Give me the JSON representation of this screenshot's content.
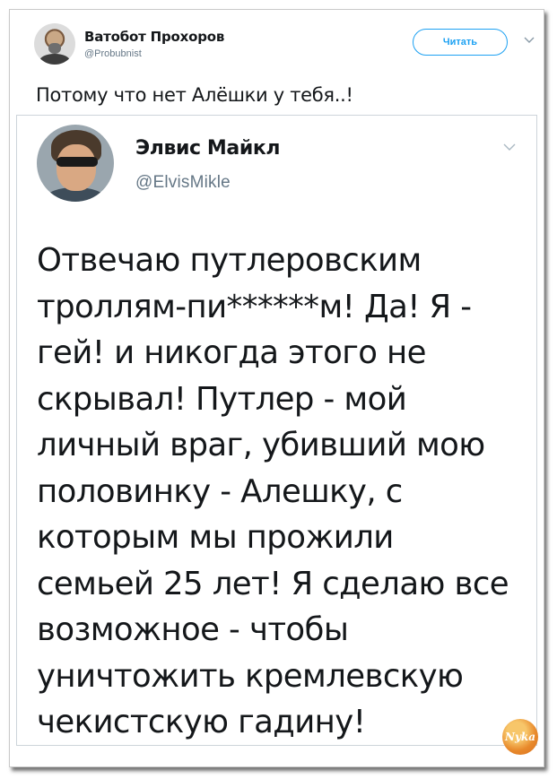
{
  "outer_tweet": {
    "author_name": "Ватобот Прохоров",
    "author_handle": "@Probubnist",
    "follow_label": "Читать",
    "text": "Потому что нет Алёшки у тебя..!"
  },
  "quoted_tweet": {
    "author_name": "Элвис Майкл",
    "author_handle": "@ElvisMikle",
    "text": "Отвечаю путлеровским\nтроллям-пи******м! Да! Я -\nгей! и никогда этого не\nскрывал! Путлер - мой\nличный враг, убивший мою\nполовинку - Алешку, с\nкоторым мы прожили\nсемьей 25 лет! Я сделаю все\nвозможное - чтобы\nуничтожить кремлевскую\nчекистскую гадину!"
  },
  "watermark_text": "Nyka",
  "icons": {
    "outer_menu": "chevron-down-icon",
    "inner_menu": "chevron-down-icon"
  },
  "colors": {
    "accent": "#1da1f2",
    "secondary_text": "#657786",
    "text": "#14171a",
    "border": "#cdd4da"
  }
}
